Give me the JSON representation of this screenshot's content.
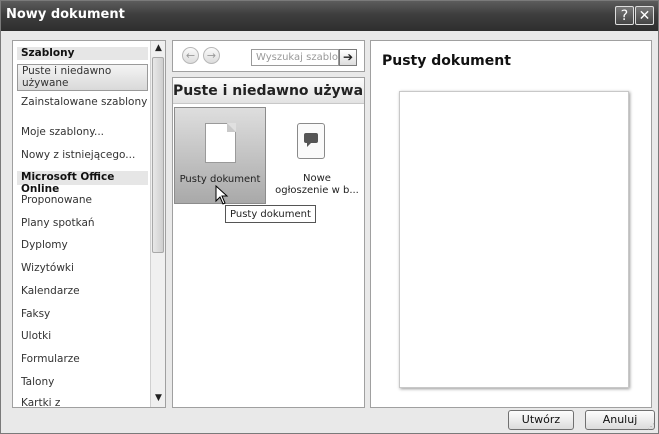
{
  "window": {
    "title": "Nowy dokument",
    "help_label": "?",
    "close_label": "✕"
  },
  "sidebar": {
    "items": [
      {
        "label": "Szablony",
        "kind": "header"
      },
      {
        "label": "Puste i niedawno używane",
        "kind": "selected"
      },
      {
        "label": "Zainstalowane szablony",
        "kind": "item"
      },
      {
        "label": "Moje szablony...",
        "kind": "item"
      },
      {
        "label": "Nowy z istniejącego...",
        "kind": "item"
      },
      {
        "label": "Microsoft Office Online",
        "kind": "header"
      },
      {
        "label": "Proponowane",
        "kind": "item"
      },
      {
        "label": "Plany spotkań",
        "kind": "item"
      },
      {
        "label": "Dyplomy",
        "kind": "item"
      },
      {
        "label": "Wizytówki",
        "kind": "item"
      },
      {
        "label": "Kalendarze",
        "kind": "item"
      },
      {
        "label": "Faksy",
        "kind": "item"
      },
      {
        "label": "Ulotki",
        "kind": "item"
      },
      {
        "label": "Formularze",
        "kind": "item"
      },
      {
        "label": "Talony",
        "kind": "item"
      },
      {
        "label": "Kartki z",
        "kind": "item"
      }
    ],
    "scroll_up": "▲",
    "scroll_down": "▼"
  },
  "nav": {
    "back": "←",
    "forward": "→",
    "search_placeholder": "Wyszukaj szablon",
    "search_go": "➔"
  },
  "templates": {
    "section_title": "Puste i niedawno używane",
    "items": [
      {
        "caption": "Pusty dokument"
      },
      {
        "caption": "Nowe ogłoszenie w b..."
      }
    ],
    "tooltip": "Pusty dokument"
  },
  "preview": {
    "title": "Pusty dokument"
  },
  "buttons": {
    "create": "Utwórz",
    "cancel": "Anuluj"
  }
}
